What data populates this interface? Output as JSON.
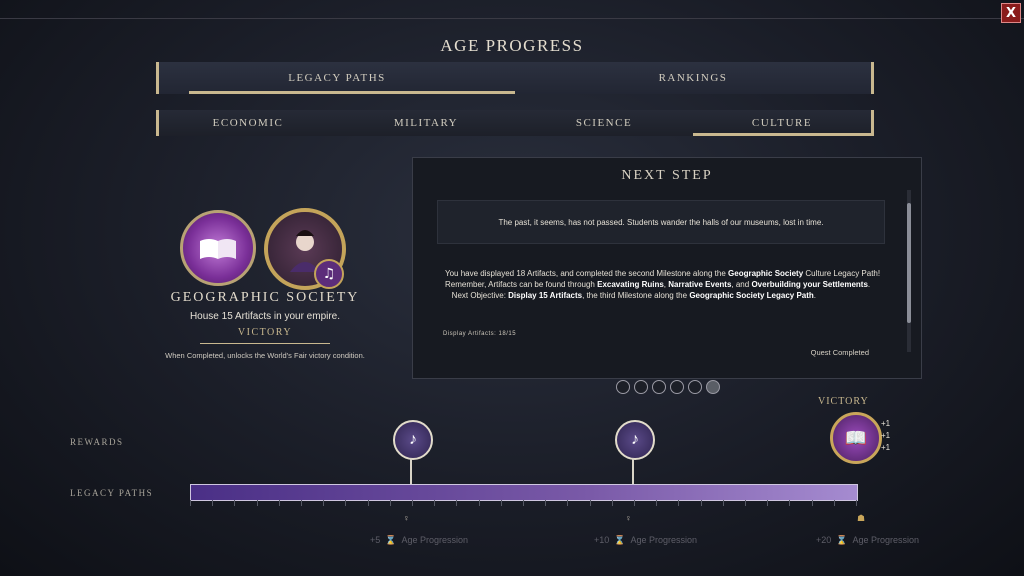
{
  "window": {
    "title": "AGE PROGRESS",
    "close_label": "X"
  },
  "main_tabs": [
    {
      "label": "LEGACY PATHS",
      "active": true
    },
    {
      "label": "RANKINGS",
      "active": false
    }
  ],
  "sub_tabs": [
    {
      "label": "ECONOMIC",
      "active": false
    },
    {
      "label": "MILITARY",
      "active": false
    },
    {
      "label": "SCIENCE",
      "active": false
    },
    {
      "label": "CULTURE",
      "active": true
    }
  ],
  "legacy": {
    "name": "GEOGRAPHIC SOCIETY",
    "description": "House 15 Artifacts in your empire.",
    "type_label": "VICTORY",
    "note": "When Completed, unlocks the World's Fair victory condition.",
    "icon": "open-book-icon",
    "leader_icon": "leader-portrait-icon",
    "badge_icon": "music-note-icon"
  },
  "next_step": {
    "title": "NEXT STEP",
    "quote": "The past, it seems, has not passed. Students wander the halls of our museums, lost in time.",
    "body_1a": "You have displayed 18 Artifacts, and completed the second Milestone along the",
    "body_1b": "Geographic Society",
    "body_1c": "Culture Legacy Path!",
    "body_2a": "Remember, Artifacts can be found through",
    "body_2b": "Excavating Ruins",
    "body_2c": "Narrative Events",
    "body_2d": "and",
    "body_2e": "Overbuilding your Settlements",
    "body_3a": "Next Objective:",
    "body_3b": "Display 15 Artifacts",
    "body_3c": ", the third Milestone along the",
    "body_3d": "Geographic Society Legacy Path",
    "progress_label": "Display Artifacts: 18/15",
    "status": "Quest Completed"
  },
  "page_dots": {
    "total": 6,
    "completed_index": 5
  },
  "track": {
    "rewards_label": "REWARDS",
    "legacy_label": "LEGACY PATHS",
    "victory_label": "VICTORY",
    "plus": [
      "+1",
      "+1",
      "+1"
    ],
    "progress_fraction": 1.0,
    "milestones": [
      {
        "reward": "+5",
        "label": "Age Progression"
      },
      {
        "reward": "+10",
        "label": "Age Progression"
      },
      {
        "reward": "+20",
        "label": "Age Progression"
      }
    ]
  }
}
